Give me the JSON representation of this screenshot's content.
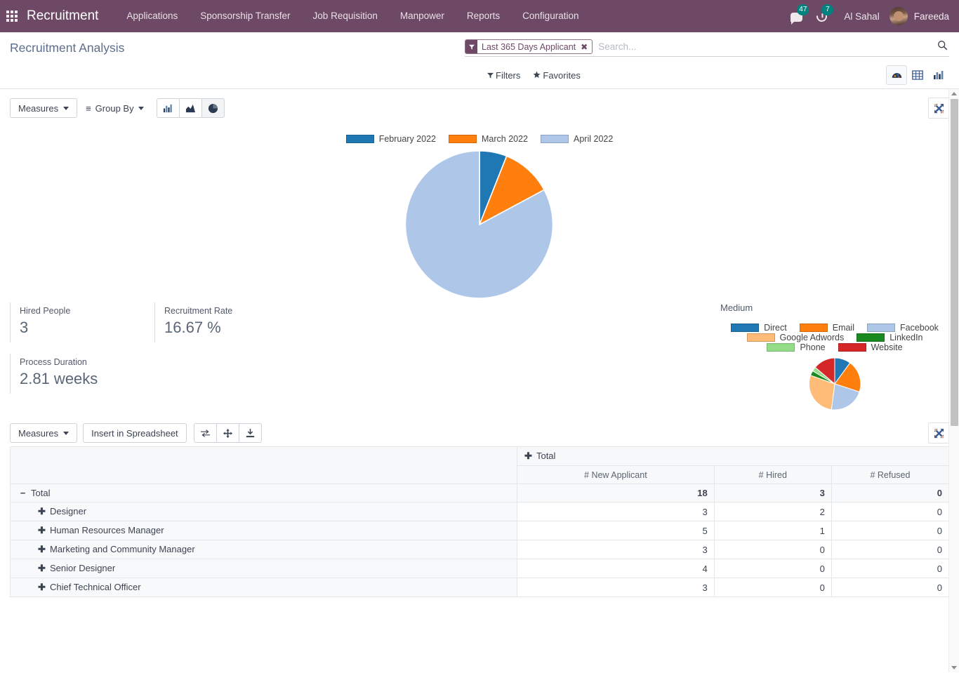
{
  "navbar": {
    "apps_icon": "apps-grid-icon",
    "brand": "Recruitment",
    "menu": [
      {
        "label": "Applications"
      },
      {
        "label": "Sponsorship Transfer"
      },
      {
        "label": "Job Requisition"
      },
      {
        "label": "Manpower"
      },
      {
        "label": "Reports"
      },
      {
        "label": "Configuration"
      }
    ],
    "messages_badge": "47",
    "activities_badge": "7",
    "company": "Al Sahal",
    "user": "Fareeda",
    "bg_color": "#6d4965"
  },
  "control_panel": {
    "title": "Recruitment Analysis",
    "facet": {
      "label": "Last 365 Days Applicant",
      "remove": "✖"
    },
    "search_placeholder": "Search...",
    "filters_label": "Filters",
    "favorites_label": "Favorites",
    "views": [
      {
        "name": "dashboard",
        "active": true
      },
      {
        "name": "list",
        "active": false
      },
      {
        "name": "graph",
        "active": false
      }
    ]
  },
  "graph_toolbar": {
    "measures_label": "Measures",
    "group_by_label": "Group By",
    "modes": [
      {
        "name": "bar",
        "active": false
      },
      {
        "name": "line",
        "active": false
      },
      {
        "name": "pie",
        "active": true
      }
    ],
    "expand_label": "expand"
  },
  "pivot_toolbar": {
    "measures_label": "Measures",
    "insert_label": "Insert in Spreadsheet",
    "flip_axis": "flip-axis-icon",
    "expand_all": "expand-all-icon",
    "download": "download-xlsx-icon"
  },
  "kpis": [
    {
      "label": "Hired People",
      "value": "3"
    },
    {
      "label": "Recruitment Rate",
      "value": "16.67 %"
    },
    {
      "label": "Process Duration",
      "value": "2.81 weeks"
    }
  ],
  "medium_section": {
    "title": "Medium"
  },
  "chart_data": [
    {
      "id": "main_pie",
      "type": "pie",
      "title": "",
      "legend_position": "top",
      "categories": [
        "February 2022",
        "March 2022",
        "April 2022"
      ],
      "values": [
        6,
        11,
        83
      ],
      "colors": [
        "#1f77b4",
        "#ff7f0e",
        "#aec7e8"
      ]
    },
    {
      "id": "medium_pie",
      "type": "pie",
      "title": "Medium",
      "legend_position": "top",
      "categories": [
        "Direct",
        "Email",
        "Facebook",
        "Google Adwords",
        "LinkedIn",
        "Phone",
        "Website"
      ],
      "values": [
        10,
        20,
        18,
        18,
        6,
        5,
        23
      ],
      "colors": [
        "#1f77b4",
        "#ff7f0e",
        "#aec7e8",
        "#ffbb78",
        "#1a8a20",
        "#93dd89",
        "#d62728"
      ]
    }
  ],
  "pivot": {
    "col_group_header": "Total",
    "measures": [
      "# New Applicant",
      "# Hired",
      "# Refused"
    ],
    "rows": [
      {
        "label": "Total",
        "toggle": "−",
        "level": 0,
        "values": [
          "18",
          "3",
          "0"
        ]
      },
      {
        "label": "Designer",
        "toggle": "✚",
        "level": 1,
        "values": [
          "3",
          "2",
          "0"
        ]
      },
      {
        "label": "Human Resources Manager",
        "toggle": "✚",
        "level": 1,
        "values": [
          "5",
          "1",
          "0"
        ]
      },
      {
        "label": "Marketing and Community Manager",
        "toggle": "✚",
        "level": 1,
        "values": [
          "3",
          "0",
          "0"
        ]
      },
      {
        "label": "Senior Designer",
        "toggle": "✚",
        "level": 1,
        "values": [
          "4",
          "0",
          "0"
        ]
      },
      {
        "label": "Chief Technical Officer",
        "toggle": "✚",
        "level": 1,
        "values": [
          "3",
          "0",
          "0"
        ]
      }
    ]
  }
}
